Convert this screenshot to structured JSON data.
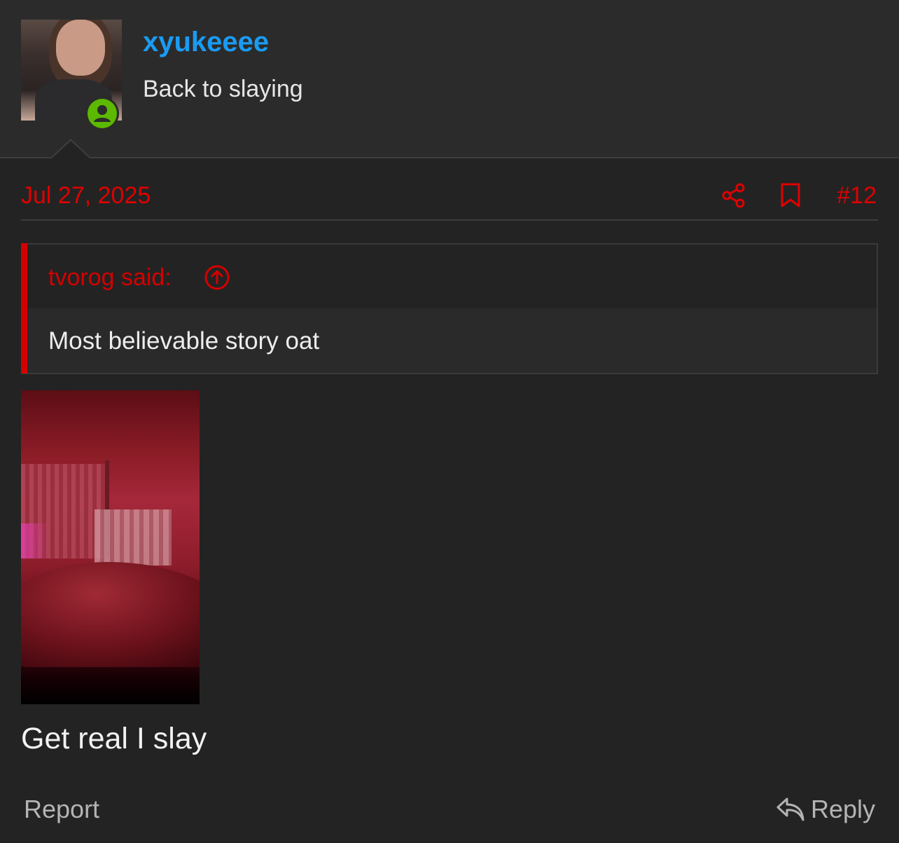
{
  "user": {
    "name": "xyukeeee",
    "title": "Back to slaying",
    "status_color": "#5cb800",
    "name_color": "#1a9bf2"
  },
  "post": {
    "date": "Jul 27, 2025",
    "number": "#12",
    "accent_color": "#e00000",
    "text": "Get real I slay"
  },
  "quote": {
    "author_label": "tvorog said:",
    "text": "Most believable story oat"
  },
  "actions": {
    "report_label": "Report",
    "reply_label": "Reply",
    "share_icon": "share-icon",
    "bookmark_icon": "bookmark-icon"
  }
}
